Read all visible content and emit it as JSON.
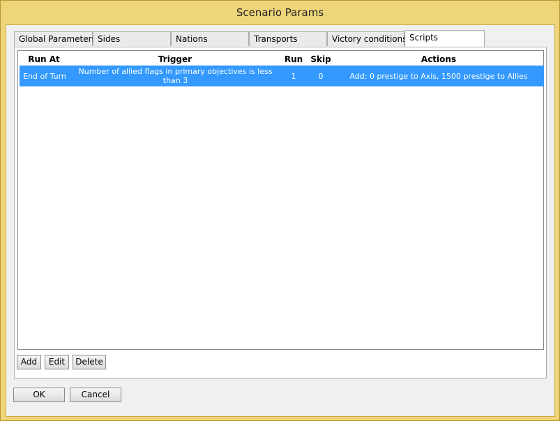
{
  "window": {
    "title": "Scenario Params"
  },
  "tabs": [
    {
      "label": "Global Parameters"
    },
    {
      "label": "Sides"
    },
    {
      "label": "Nations"
    },
    {
      "label": "Transports"
    },
    {
      "label": "Victory conditions"
    },
    {
      "label": "Scripts",
      "active": true
    }
  ],
  "scripts_table": {
    "columns": [
      "Run At",
      "Trigger",
      "Run",
      "Skip",
      "Actions"
    ],
    "rows": [
      {
        "run_at": "End of Turn",
        "trigger": "Number of allied flags in primary objectives is less than 3",
        "run": "1",
        "skip": "0",
        "actions": "Add: 0 prestige to Axis, 1500 prestige to Allies",
        "selected": true
      }
    ]
  },
  "panel_buttons": {
    "add": "Add",
    "edit": "Edit",
    "delete": "Delete"
  },
  "dialog_buttons": {
    "ok": "OK",
    "cancel": "Cancel"
  },
  "colors": {
    "selection": "#3399ff",
    "frame": "#efd57a"
  }
}
